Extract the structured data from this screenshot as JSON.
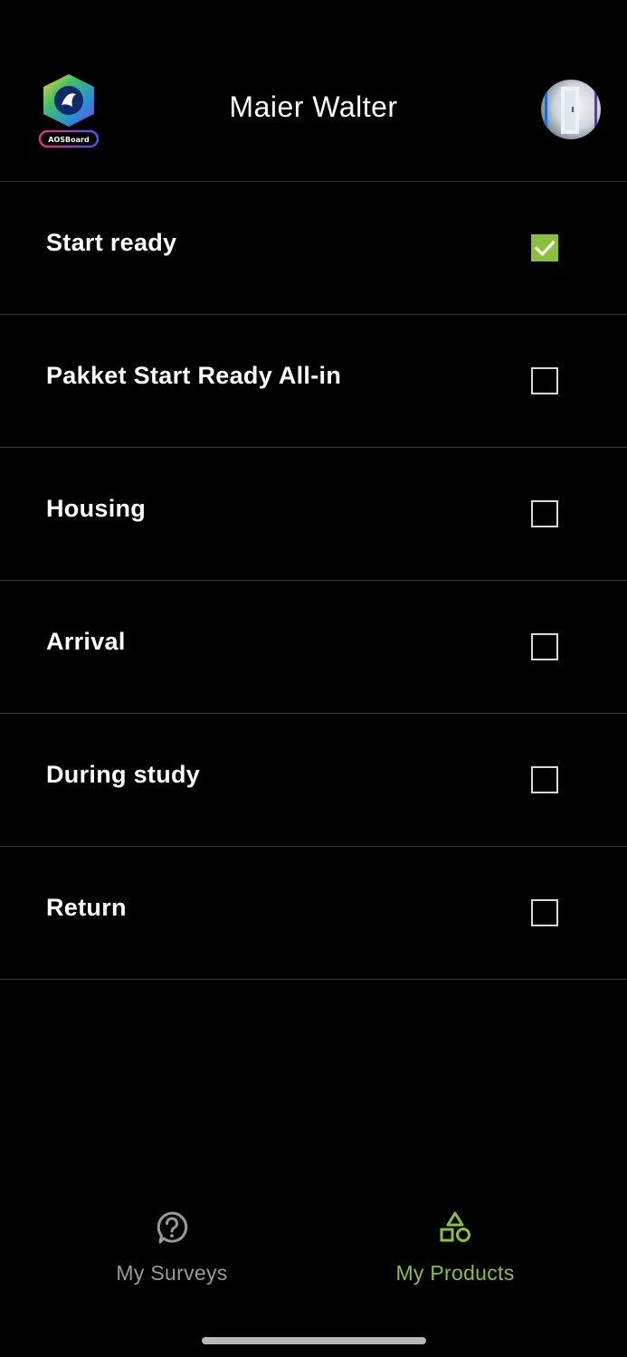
{
  "header": {
    "title": "Maier Walter",
    "logo_text": "AOSBoard"
  },
  "products": [
    {
      "label": "Start ready",
      "checked": true
    },
    {
      "label": "Pakket Start Ready All-in",
      "checked": false
    },
    {
      "label": "Housing",
      "checked": false
    },
    {
      "label": "Arrival",
      "checked": false
    },
    {
      "label": "During study",
      "checked": false
    },
    {
      "label": "Return",
      "checked": false
    }
  ],
  "tabs": [
    {
      "label": "My Surveys",
      "icon": "question-circle-icon",
      "active": false
    },
    {
      "label": "My Products",
      "icon": "shapes-icon",
      "active": true
    }
  ],
  "colors": {
    "accent": "#8cbf3f",
    "inactive_tab": "#9a9a9a",
    "background": "#000000"
  }
}
